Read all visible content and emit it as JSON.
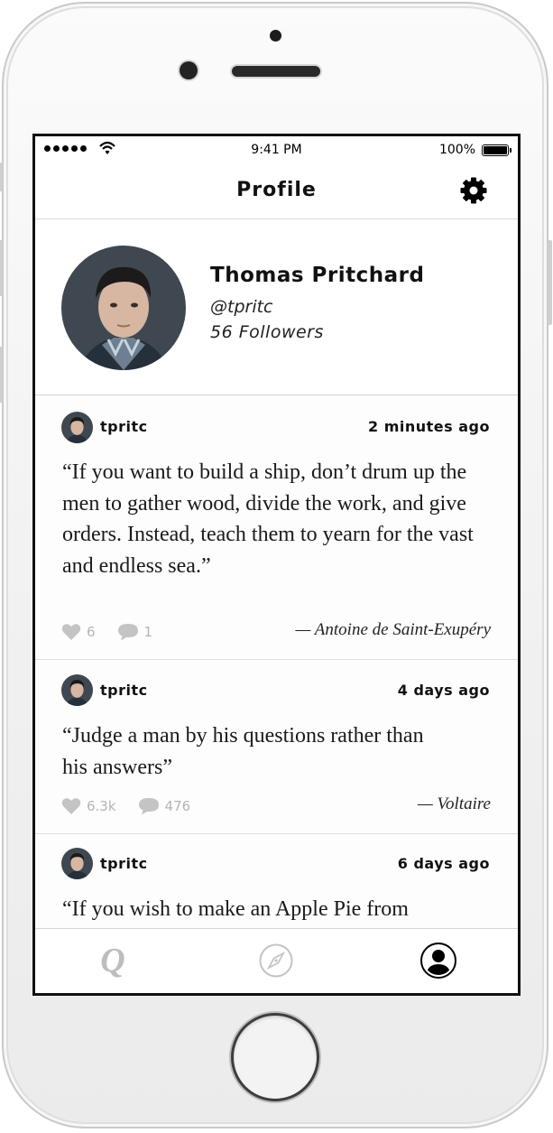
{
  "status_bar": {
    "time": "9:41 PM",
    "battery": "100%"
  },
  "nav": {
    "title": "Profile",
    "settings_icon": "gear-icon"
  },
  "profile": {
    "name": "Thomas Pritchard",
    "handle": "@tpritc",
    "followers": "56 Followers"
  },
  "posts": [
    {
      "username": "tpritc",
      "time": "2 minutes ago",
      "quote": "“If you want to build a ship, don’t drum up the men to gather wood, divide the work, and give orders. Instead, teach them to yearn for the vast and endless sea.”",
      "likes": "6",
      "comments": "1",
      "author": "— Antoine de Saint-Exupéry"
    },
    {
      "username": "tpritc",
      "time": "4 days ago",
      "quote": "“Judge a man by his questions rather than his answers”",
      "likes": "6.3k",
      "comments": "476",
      "author": "— Voltaire"
    },
    {
      "username": "tpritc",
      "time": "6 days ago",
      "quote": "“If you wish to make an Apple Pie from"
    }
  ],
  "tabs": {
    "quotes_glyph": "Q",
    "items": [
      "quotes-icon",
      "compass-icon",
      "profile-icon"
    ],
    "active": "profile-icon"
  },
  "colors": {
    "text": "#111111",
    "muted_icon": "#b5b5b5",
    "divider": "#dedede"
  }
}
